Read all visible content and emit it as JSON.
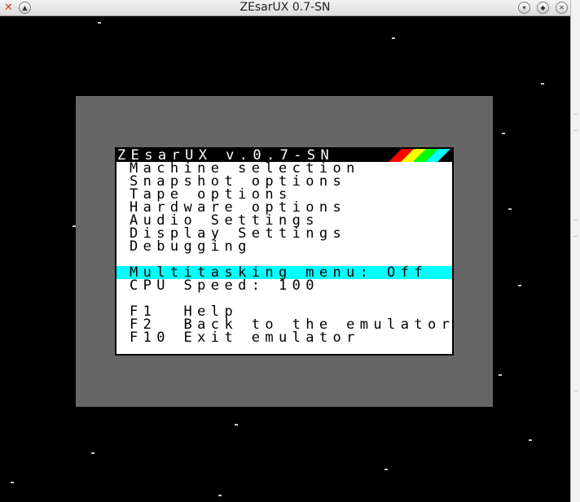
{
  "window": {
    "title": "ZEsarUX 0.7-SN",
    "icons": {
      "app": "x-app-icon",
      "collapse": "chevron-up-icon",
      "minimize": "minimize-icon",
      "maximize": "maximize-icon",
      "close": "close-icon"
    }
  },
  "colors": {
    "background": "#000000",
    "border_area": "#666666",
    "menu_bg": "#ffffff",
    "menu_header_bg": "#000000",
    "selection": "#00ffff",
    "stripes": [
      "#ff0000",
      "#ffff00",
      "#00ff00",
      "#00ffff"
    ]
  },
  "menu": {
    "title": "ZEsarUX v.0.7-SN",
    "items": [
      {
        "label": "Machine selection"
      },
      {
        "label": "Snapshot options"
      },
      {
        "label": "Tape options"
      },
      {
        "label": "Hardware options"
      },
      {
        "label": "Audio Settings"
      },
      {
        "label": "Display Settings"
      },
      {
        "label": "Debugging"
      },
      {
        "label": ""
      },
      {
        "label": "Multitasking menu: Off",
        "selected": true
      },
      {
        "label": "CPU Speed: 100"
      },
      {
        "label": ""
      },
      {
        "label": "F1  Help"
      },
      {
        "label": "F2  Back to the emulator"
      },
      {
        "label": "F10 Exit emulator"
      }
    ]
  }
}
